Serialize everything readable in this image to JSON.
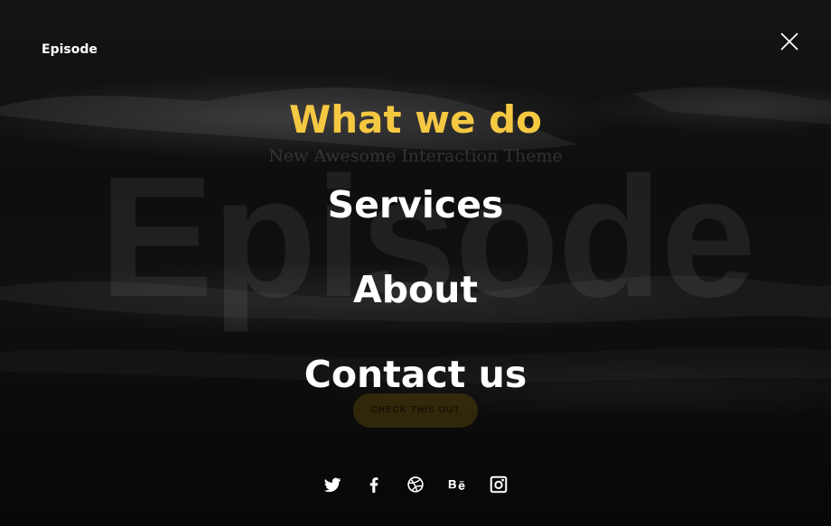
{
  "header": {
    "brand": "Episode",
    "close_icon": "close-icon"
  },
  "background": {
    "big_word": "Episode",
    "tagline": "New Awesome Interaction Theme",
    "cta_label": "CHECK THIS OUT"
  },
  "menu": {
    "items": [
      {
        "label": "What we do",
        "active": true
      },
      {
        "label": "Services",
        "active": false
      },
      {
        "label": "About",
        "active": false
      },
      {
        "label": "Contact us",
        "active": false
      }
    ],
    "active_color": "#f5c842",
    "item_color": "#ffffff"
  },
  "social": {
    "icons": [
      "twitter-icon",
      "facebook-icon",
      "dribbble-icon",
      "behance-icon",
      "instagram-icon"
    ]
  }
}
